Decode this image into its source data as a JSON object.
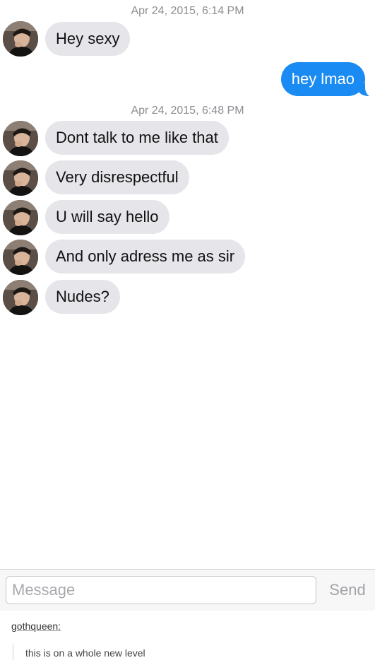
{
  "conversation": {
    "groups": [
      {
        "timestamp": "Apr 24, 2015, 6:14 PM"
      },
      {
        "timestamp": "Apr 24, 2015, 6:48 PM"
      }
    ],
    "messages": [
      {
        "direction": "incoming",
        "text": "Hey sexy"
      },
      {
        "direction": "outgoing",
        "text": "hey lmao"
      },
      {
        "direction": "incoming",
        "text": "Dont talk to me like that"
      },
      {
        "direction": "incoming",
        "text": "Very disrespectful"
      },
      {
        "direction": "incoming",
        "text": "U will say hello"
      },
      {
        "direction": "incoming",
        "text": "And only adress me as sir"
      },
      {
        "direction": "incoming",
        "text": "Nudes?"
      }
    ]
  },
  "composer": {
    "placeholder": "Message",
    "send_label": "Send"
  },
  "tumblr": {
    "username": "gothqueen:",
    "comment": "this is on a whole new level"
  },
  "colors": {
    "incoming_bubble": "#e5e5ea",
    "outgoing_bubble": "#1a8bf2",
    "timestamp_text": "#8e8e93"
  }
}
